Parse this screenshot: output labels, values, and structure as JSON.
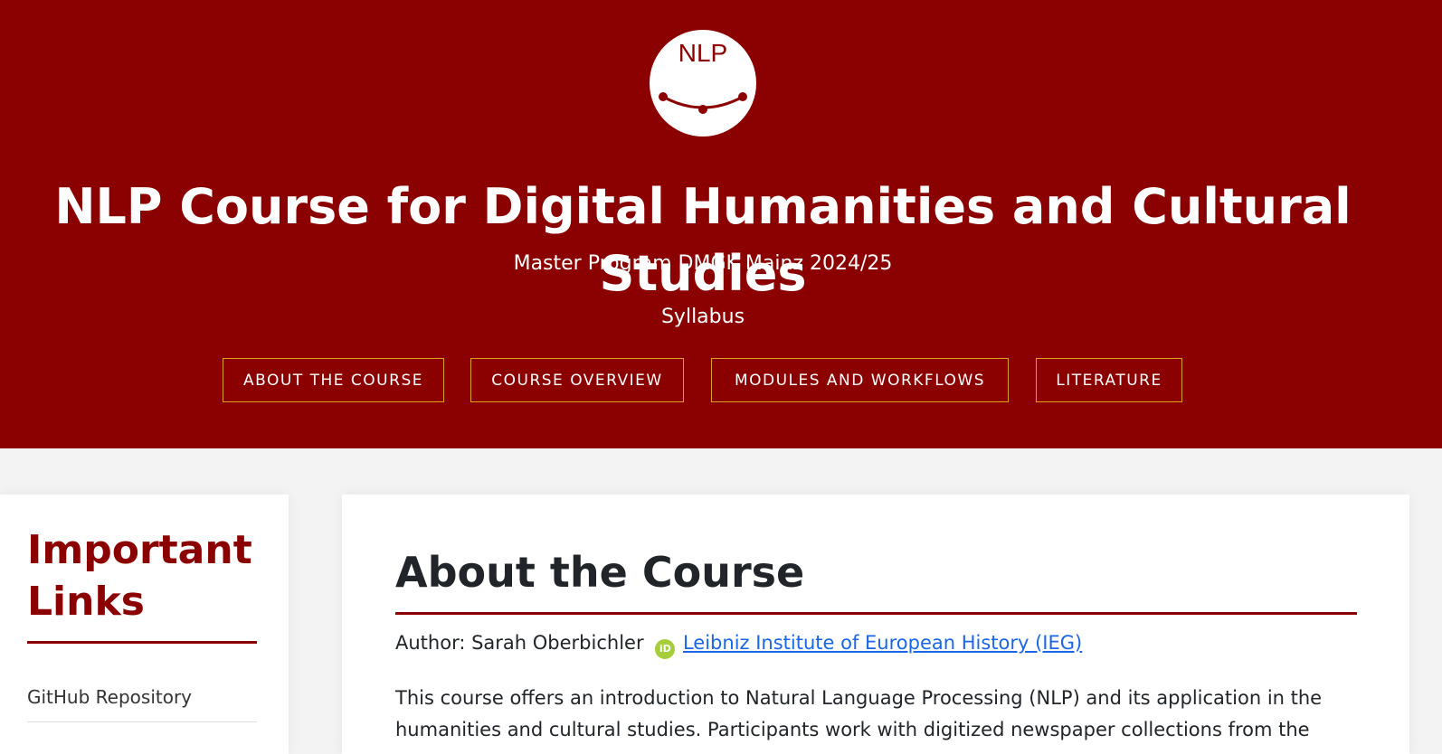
{
  "header": {
    "logo_text": "NLP",
    "title": "NLP Course for Digital Humanities and Cultural Studies",
    "subtitle": "Master Program DMGK Mainz 2024/25",
    "syllabus": "Syllabus",
    "nav": [
      {
        "label": "About the Course"
      },
      {
        "label": "Course Overview"
      },
      {
        "label": "Modules and Workflows"
      },
      {
        "label": "Literature"
      }
    ]
  },
  "sidebar": {
    "title": "Important Links",
    "links": [
      {
        "label": "GitHub Repository"
      }
    ]
  },
  "main": {
    "title": "About the Course",
    "author_prefix": "Author: Sarah Oberbichler",
    "orcid_badge": "iD",
    "affiliation": "Leibniz Institute of European History (IEG)",
    "intro": "This course offers an introduction to Natural Language Processing (NLP) and its application in the humanities and cultural studies. Participants work with digitized newspaper collections from the"
  },
  "colors": {
    "brand": "#8b0000",
    "nav_border": "#e0a020",
    "link": "#1a66e6",
    "orcid": "#a6ce39"
  }
}
